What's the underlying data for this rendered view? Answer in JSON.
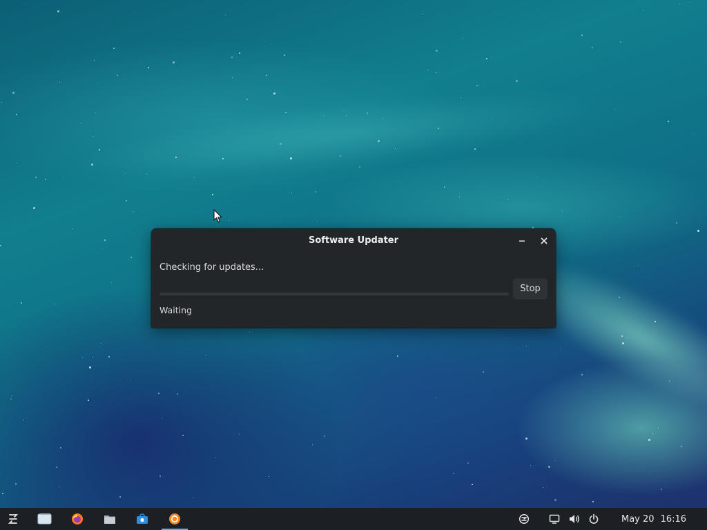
{
  "dialog": {
    "title": "Software Updater",
    "message": "Checking for updates...",
    "progress": 0,
    "stop_label": "Stop",
    "substatus": "Waiting"
  },
  "taskbar": {
    "apps": [
      {
        "icon": "zorin-menu-icon"
      },
      {
        "icon": "workspace-switcher-icon"
      },
      {
        "icon": "firefox-icon"
      },
      {
        "icon": "files-icon"
      },
      {
        "icon": "software-store-icon"
      },
      {
        "icon": "software-updater-icon",
        "active": true
      }
    ],
    "tray": [
      {
        "icon": "zorin-connect-icon"
      },
      {
        "icon": "display-icon"
      },
      {
        "icon": "volume-icon"
      },
      {
        "icon": "power-icon"
      }
    ],
    "date": "May 20",
    "time": "16:16"
  },
  "colors": {
    "dialog_bg": "#232629",
    "taskbar_bg": "#1c2024",
    "accent": "#5ab3ef"
  }
}
